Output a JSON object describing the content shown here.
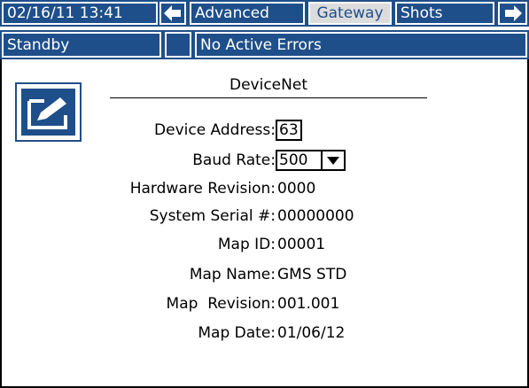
{
  "header": {
    "datetime": "02/16/11 13:41",
    "tabs": [
      {
        "label": "Advanced"
      },
      {
        "label": "Gateway"
      },
      {
        "label": "Shots"
      }
    ],
    "left_arrow_icon": "arrow-left-icon",
    "right_arrow_icon": "arrow-right-icon"
  },
  "status_bar": {
    "mode": "Standby",
    "errors": "No Active Errors"
  },
  "edit_icon": "edit-pencil-icon",
  "section": {
    "title": "DeviceNet"
  },
  "fields": {
    "device_address": {
      "label": "Device Address:",
      "value": "63"
    },
    "baud_rate": {
      "label": "Baud Rate:",
      "value": "500"
    },
    "hardware_revision": {
      "label": "Hardware Revision:",
      "value": "0000"
    },
    "system_serial": {
      "label": "System Serial #:",
      "value": "00000000"
    },
    "map_id": {
      "label": "Map ID:",
      "value": "00001"
    },
    "map_name": {
      "label": "Map Name:",
      "value": "GMS STD"
    },
    "map_revision": {
      "label": "Map  Revision:",
      "value": "001.001"
    },
    "map_date": {
      "label": "Map Date:",
      "value": "01/06/12"
    }
  },
  "colors": {
    "header_blue": "#1f4f8a",
    "selected_tab": "#dcdcdc",
    "background": "#ffffff"
  }
}
